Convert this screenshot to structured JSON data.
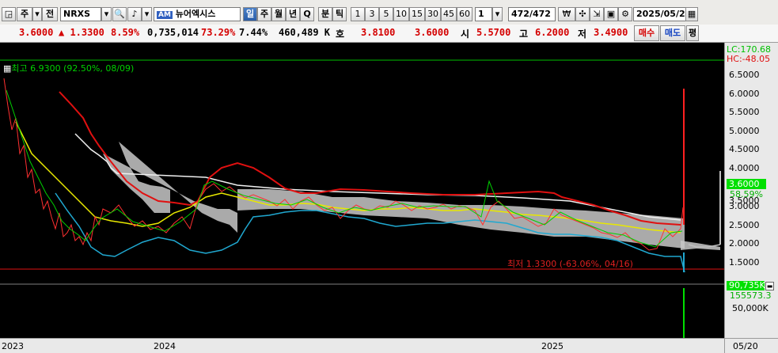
{
  "toolbar": {
    "btn1": "주",
    "btn2": "전",
    "ticker": "NRXS",
    "name": "뉴어엑시스",
    "periods": [
      "일",
      "주",
      "월",
      "년",
      "Q",
      "분",
      "틱"
    ],
    "intervals": [
      "1",
      "3",
      "5",
      "10",
      "15",
      "30",
      "45",
      "60"
    ],
    "step": "1",
    "counter": "472/472",
    "date": "2025/05/2"
  },
  "quote": {
    "price": "3.6000",
    "change": "▲ 1.3300",
    "change_pct": "8.59%",
    "volume": "0,735,014",
    "turnover_pct": "73.29%",
    "ratio": "7.44%",
    "amount": "460,489 K",
    "bid_label": "호",
    "bid": "3.8100",
    "ask": "3.6000",
    "open_label": "시",
    "open": "5.5700",
    "high_label": "고",
    "high": "6.2000",
    "low_label": "저",
    "low": "3.4900",
    "buy": "매수",
    "sell": "매도",
    "avg": "평"
  },
  "chart": {
    "high_note": "최고 6.9300 (92.50%, 08/09)",
    "low_note": "최저 1.3300 (-63.06%, 04/16)",
    "lc": "LC:170.68",
    "hc": "HC:-48.05",
    "price_tag": "3.6000",
    "pct_tag": "58.59%",
    "vol_tag": "90,735K",
    "vol_tag2": "155573.3",
    "price_ticks": [
      "6.5000",
      "6.0000",
      "5.5000",
      "5.0000",
      "4.5000",
      "4.0000",
      "3.5000",
      "3.0000",
      "2.5000",
      "2.0000",
      "1.5000"
    ],
    "vol_tick": "50,000K",
    "x_labels": [
      "2023",
      "2024",
      "2025"
    ],
    "x_right": "05/20",
    "colors": {
      "up": "#ff3030",
      "down": "#30c0ff",
      "ma_red": "#e01010",
      "ma_yellow": "#e8e800",
      "ma_blue": "#20a8d0",
      "cloud": "#c8c8c8",
      "vol": "#00e000"
    }
  }
}
